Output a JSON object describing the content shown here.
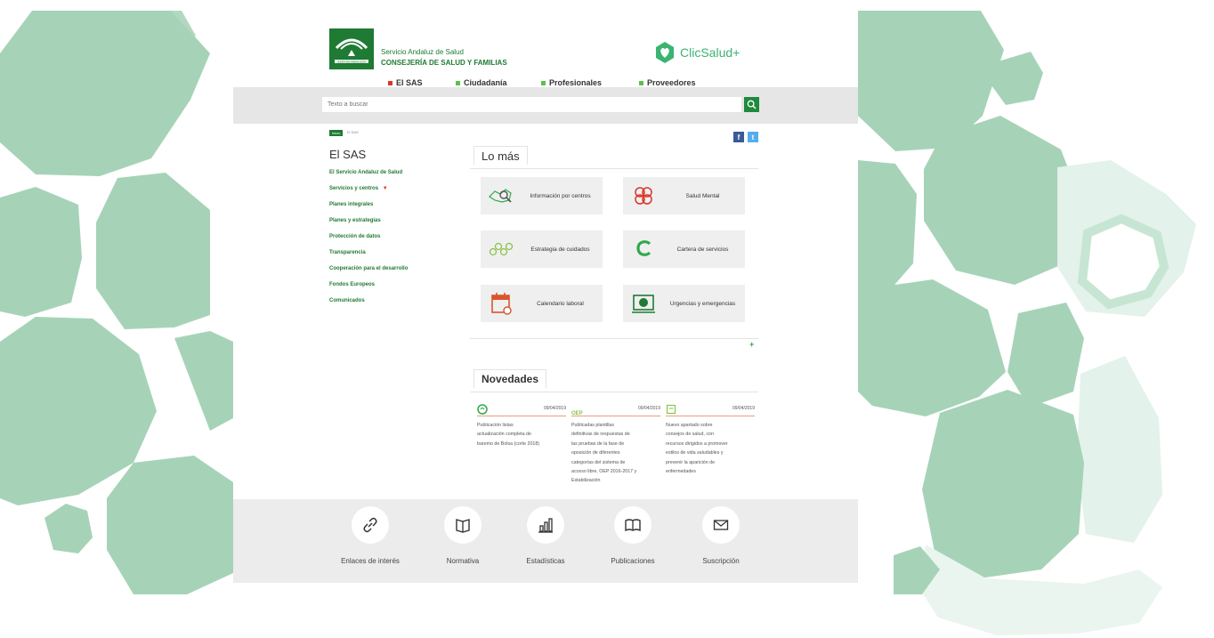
{
  "header": {
    "org_line1": "Servicio Andaluz de Salud",
    "org_line2": "CONSEJERÍA DE SALUD Y FAMILIAS",
    "logo_caption": "JUNTA DE ANDALUCIA",
    "brand": "ClicSalud+",
    "brand_color": "#3cb371"
  },
  "nav": [
    {
      "label": "El SAS",
      "color": "#d9362b"
    },
    {
      "label": "Ciudadanía",
      "color": "#5cc14a"
    },
    {
      "label": "Profesionales",
      "color": "#5cc14a"
    },
    {
      "label": "Proveedores",
      "color": "#5cc14a"
    }
  ],
  "search": {
    "placeholder": "Texto a buscar",
    "icon": "search-icon"
  },
  "breadcrumb": {
    "home": "Inicio",
    "current": "El SAS"
  },
  "social": [
    {
      "icon": "facebook-icon",
      "glyph": "f",
      "color": "#3b5998"
    },
    {
      "icon": "twitter-icon",
      "glyph": "t",
      "color": "#55acee"
    }
  ],
  "sidebar": {
    "title": "El SAS",
    "items": [
      {
        "label": "El Servicio Andaluz de Salud"
      },
      {
        "label": "Servicios y centros"
      },
      {
        "label": "Planes integrales"
      },
      {
        "label": "Planes y estrategias"
      },
      {
        "label": "Protección de datos"
      },
      {
        "label": "Transparencia"
      },
      {
        "label": "Cooperación para el desarrollo"
      },
      {
        "label": "Fondos Europeos"
      },
      {
        "label": "Comunicados"
      }
    ],
    "dropdown_icon": "caret-down-icon"
  },
  "lo_mas": {
    "title": "Lo más",
    "tiles": [
      {
        "label": "Información por centros",
        "icon": "map-search-icon"
      },
      {
        "label": "Salud Mental",
        "icon": "flower-icon"
      },
      {
        "label": "Estrategia de cuidados",
        "icon": "molecule-icon"
      },
      {
        "label": "Cartera de servicios",
        "icon": "cs-logo-icon"
      },
      {
        "label": "Calendario laboral",
        "icon": "calendar-icon"
      },
      {
        "label": "Urgencias y emergencias",
        "icon": "emergency-icon"
      }
    ],
    "more": "+"
  },
  "novedades": {
    "title": "Novedades",
    "items": [
      {
        "date": "09/04/2019",
        "icon": "swirl-icon",
        "tag": "",
        "text": [
          "Publicación listas",
          "actualización completa de",
          "baremo de Bolsa (corte 2018)"
        ]
      },
      {
        "date": "09/04/2019",
        "icon": "",
        "tag": "OEP",
        "text": [
          "Publicadas plantillas",
          "definitivas de respuestas de",
          "las pruebas de la fase de",
          "oposición de diferentes",
          "categorías del sistema de",
          "acceso libre, OEP 2016-2017 y",
          "Estabilización"
        ]
      },
      {
        "date": "09/04/2019",
        "icon": "note-icon",
        "tag": "",
        "text": [
          "Nuevo apartado sobre",
          "consejos de salud, con",
          "recursos dirigidos a promover",
          "estilos de vida saludables y",
          "prevenir la aparición de",
          "enfermedades"
        ]
      }
    ]
  },
  "footer": [
    {
      "label": "Enlaces de interés",
      "icon": "link-icon"
    },
    {
      "label": "Normativa",
      "icon": "book-icon"
    },
    {
      "label": "Estadísticas",
      "icon": "bar-chart-icon"
    },
    {
      "label": "Publicaciones",
      "icon": "open-book-icon"
    },
    {
      "label": "Suscripción",
      "icon": "envelope-icon"
    }
  ]
}
